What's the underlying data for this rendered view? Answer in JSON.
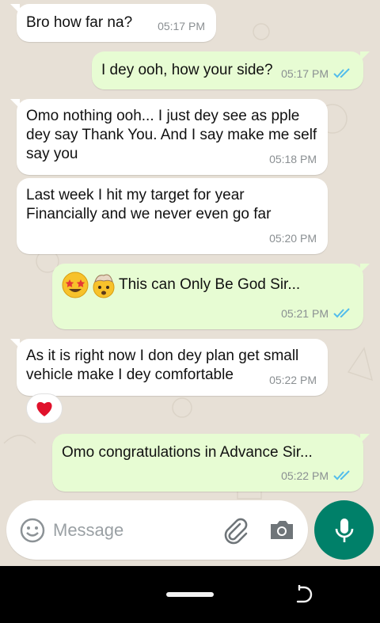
{
  "messages": [
    {
      "direction": "in",
      "text": "Bro how far na?",
      "time": "05:17 PM"
    },
    {
      "direction": "out",
      "text": "I dey ooh, how your side?",
      "time": "05:17 PM",
      "status": "read"
    },
    {
      "direction": "in",
      "text": "Omo nothing ooh... I just dey see as pple dey say Thank You. And I say make me self say you",
      "time": "05:18 PM"
    },
    {
      "direction": "in",
      "text": "Last week I hit my target for year Financially and we never even go far",
      "time": "05:20 PM"
    },
    {
      "direction": "out",
      "text": "This can Only Be God Sir...",
      "emojis": [
        "star-struck-emoji",
        "exploding-head-emoji"
      ],
      "time": "05:21 PM",
      "status": "read"
    },
    {
      "direction": "in",
      "text": "As it is right now I don dey plan get small vehicle make I dey comfortable",
      "time": "05:22 PM",
      "reaction": "heart-emoji"
    },
    {
      "direction": "out",
      "text": "Omo congratulations in Advance Sir...",
      "time": "05:22 PM",
      "status": "read"
    }
  ],
  "composer": {
    "placeholder": "Message",
    "icons": [
      "emoji-icon",
      "attach-icon",
      "camera-icon"
    ],
    "send_icon": "mic-icon"
  },
  "colors": {
    "incoming_bubble": "#ffffff",
    "outgoing_bubble": "#e7fcd3",
    "read_ticks": "#53bdeb",
    "accent": "#008069"
  }
}
